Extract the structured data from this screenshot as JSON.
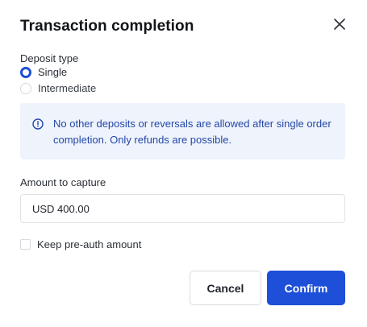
{
  "dialog": {
    "title": "Transaction completion",
    "close_icon": "close-icon"
  },
  "deposit_type": {
    "label": "Deposit type",
    "options": [
      {
        "label": "Single",
        "checked": true
      },
      {
        "label": "Intermediate",
        "checked": false
      }
    ]
  },
  "info": {
    "icon": "info-icon",
    "text": "No other deposits or reversals are allowed after single order completion. Only refunds are possible."
  },
  "amount": {
    "label": "Amount to capture",
    "value": "USD 400.00"
  },
  "keep_preauth": {
    "label": "Keep pre-auth amount",
    "checked": false
  },
  "actions": {
    "cancel_label": "Cancel",
    "confirm_label": "Confirm"
  },
  "colors": {
    "primary": "#1d4fd8",
    "info_bg": "#eef3fc",
    "info_text": "#2446a8"
  }
}
